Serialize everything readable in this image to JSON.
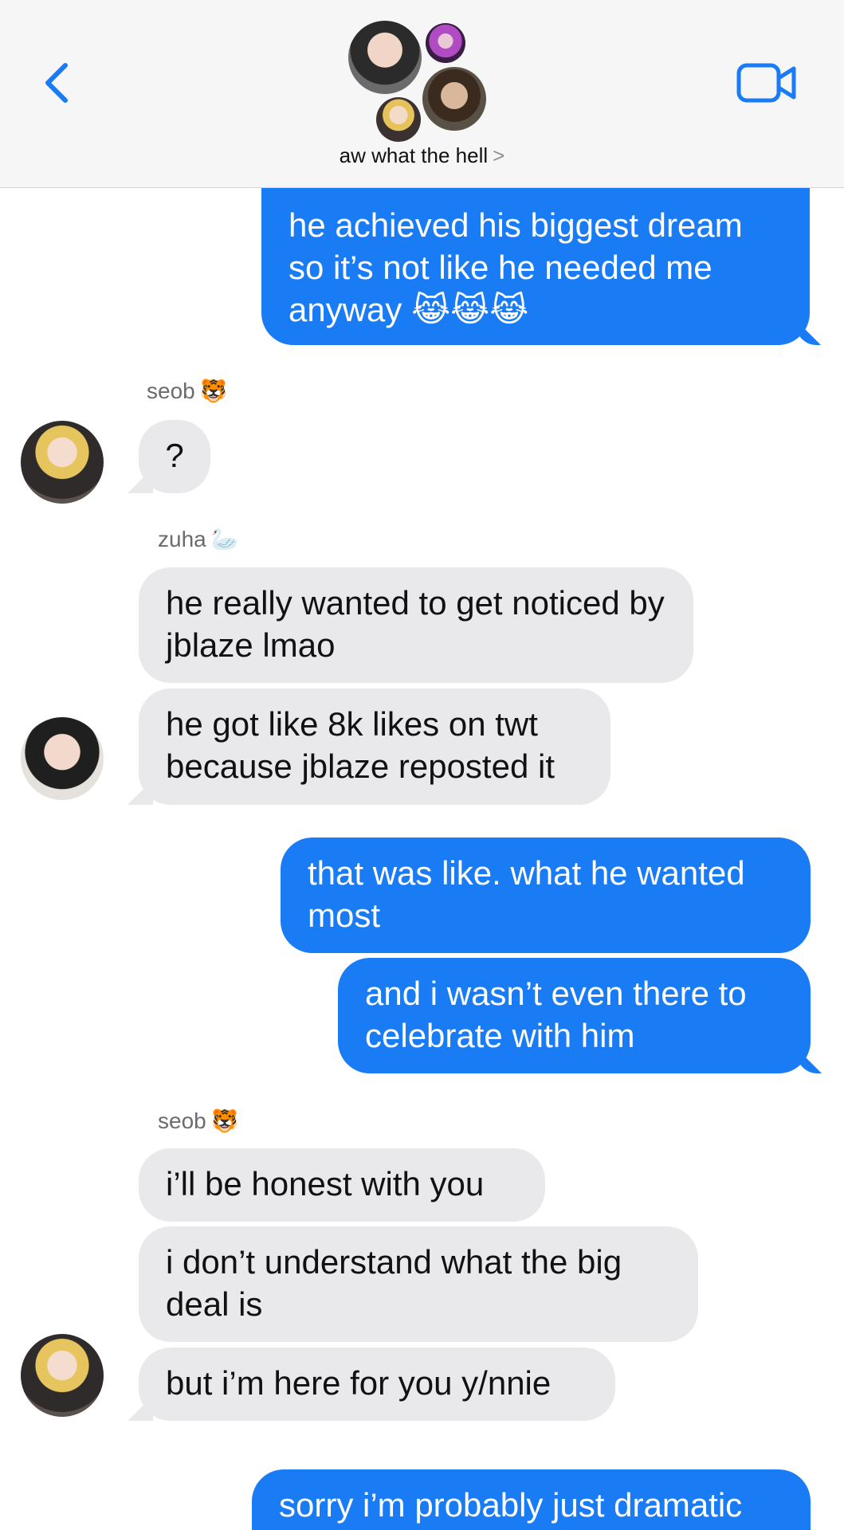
{
  "header": {
    "group_name": "aw what the hell",
    "chevron": ">",
    "back_icon": "chevron-left-icon",
    "video_icon": "video-camera-icon",
    "accent_color": "#1a7cf5"
  },
  "messages": [
    {
      "from": "me",
      "text": "he achieved his biggest dream so it’s not like he needed me anyway 😹😹😹"
    },
    {
      "sender": "seob",
      "sender_emoji": "🐯",
      "text": "?"
    },
    {
      "sender": "zuha",
      "sender_emoji": "🦢",
      "text": "he really wanted to get noticed by jblaze lmao"
    },
    {
      "text": "he got like 8k likes on twt because jblaze reposted it"
    },
    {
      "from": "me",
      "text": "that was like. what he wanted most"
    },
    {
      "from": "me",
      "text": "and i wasn’t even there to celebrate with him"
    },
    {
      "sender": "seob",
      "sender_emoji": "🐯",
      "text": "i’ll be honest with you"
    },
    {
      "text": "i don’t understand what the big deal is"
    },
    {
      "text": "but i’m here for you y/nnie"
    },
    {
      "from": "me",
      "text": "sorry i’m probably just dramatic"
    }
  ],
  "colors": {
    "outgoing_bubble": "#1a7cf5",
    "incoming_bubble": "#e9e9eb",
    "header_bg": "#f6f6f6"
  }
}
